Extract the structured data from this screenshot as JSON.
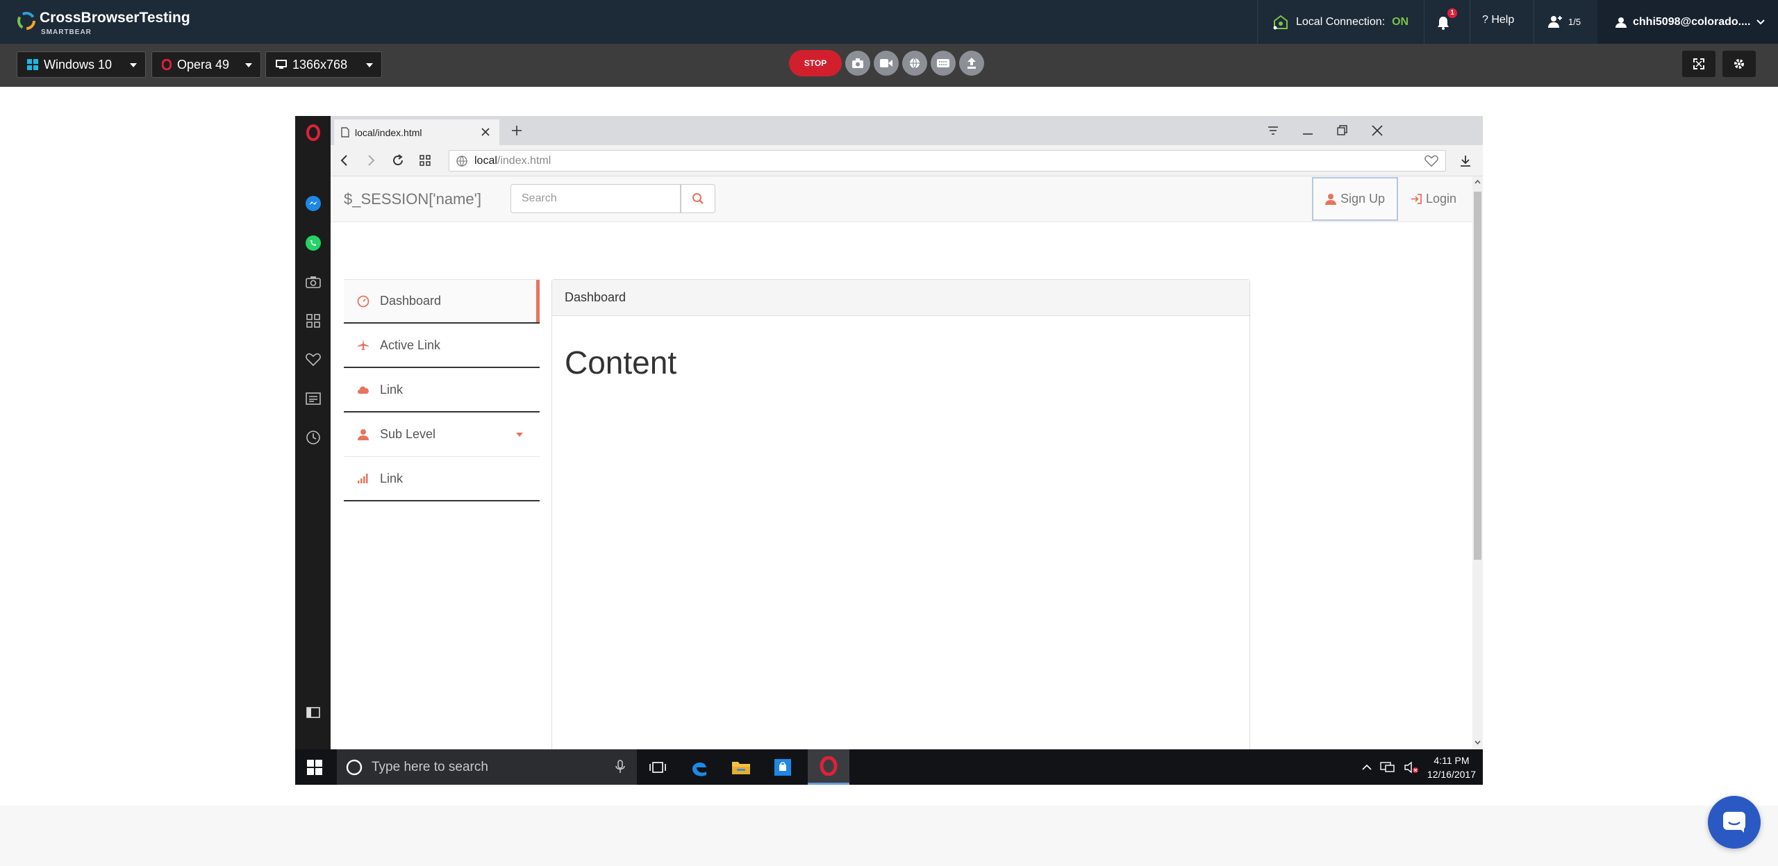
{
  "cbt": {
    "brand": "CrossBrowserTesting",
    "brand_sub": "SMARTBEAR",
    "local_connection_label": "Local Connection:",
    "local_connection_status": "ON",
    "notification_count": "1",
    "help_label": "? Help",
    "users_count": "1/5",
    "account_name": "chhi5098@colorado....",
    "os_select": "Windows 10",
    "browser_select": "Opera 49",
    "resolution_select": "1366x768",
    "stop_label": "STOP",
    "tools": [
      "screenshot-icon",
      "video-icon",
      "network-icon",
      "keyboard-icon",
      "upload-icon"
    ],
    "colors": {
      "topbar": "#1d2a38",
      "stop": "#d21f2e",
      "on": "#7cc04b"
    }
  },
  "browser": {
    "tab_title": "local/index.html",
    "url_host": "local",
    "url_path": "/index.html"
  },
  "page": {
    "brand": "$_SESSION['name']",
    "search_placeholder": "Search",
    "signup_label": "Sign Up",
    "login_label": "Login",
    "sidebar": {
      "items": [
        {
          "label": "Dashboard",
          "icon": "dashboard-icon"
        },
        {
          "label": "Active Link",
          "icon": "plane-icon"
        },
        {
          "label": "Link",
          "icon": "cloud-icon"
        },
        {
          "label": "Sub Level",
          "icon": "user-icon"
        },
        {
          "label": "Link",
          "icon": "signal-icon"
        }
      ]
    },
    "panel_heading": "Dashboard",
    "panel_content": "Content",
    "accent_color": "#e8735e"
  },
  "taskbar": {
    "search_placeholder": "Type here to search",
    "time": "4:11 PM",
    "date": "12/16/2017"
  }
}
